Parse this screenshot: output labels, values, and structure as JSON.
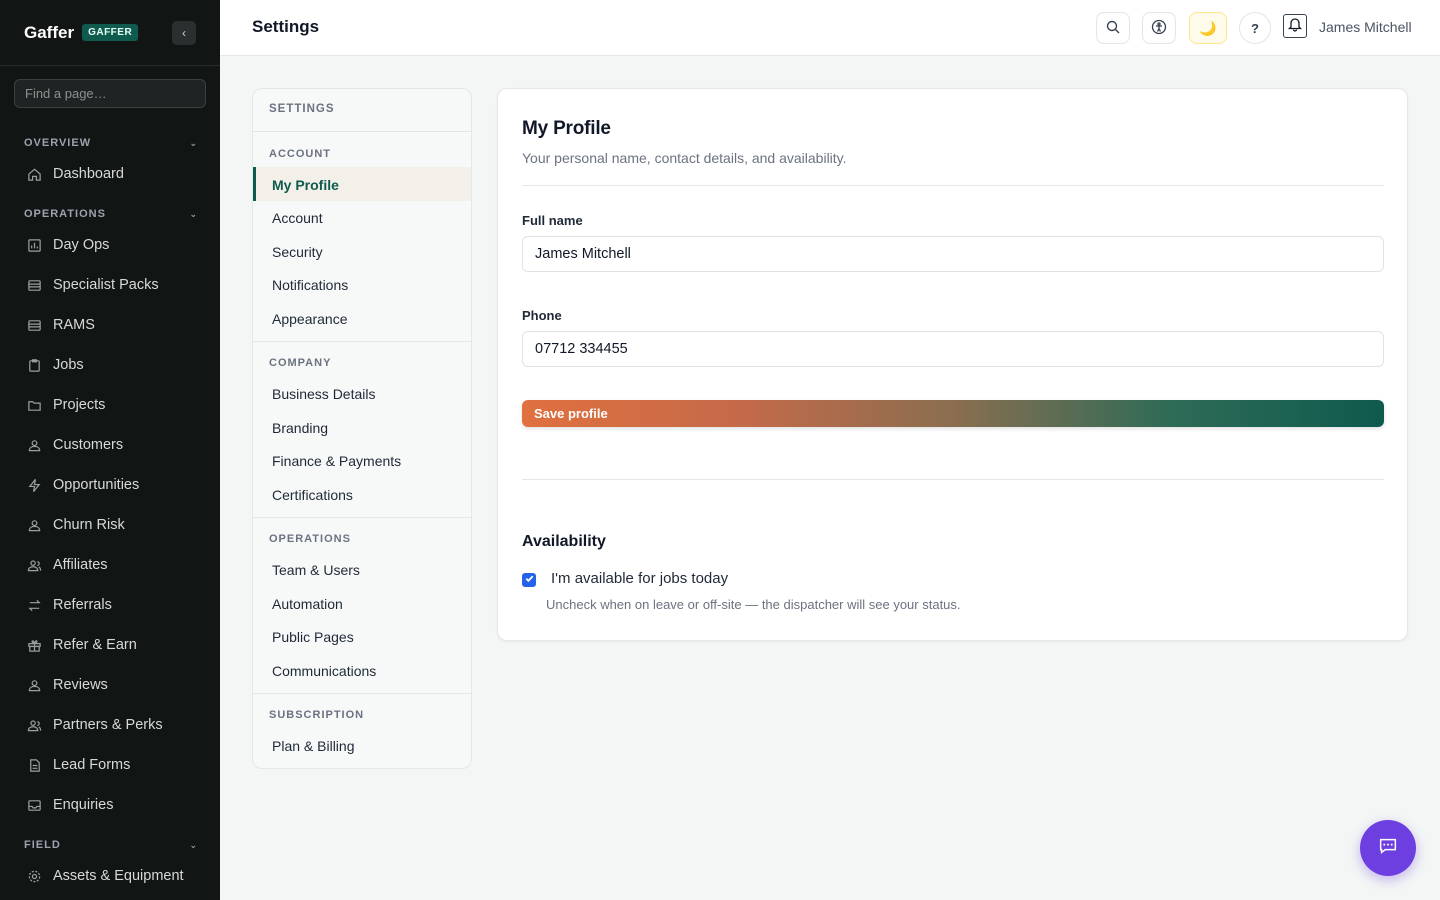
{
  "sidebar": {
    "brand": "Gaffer",
    "badge": "GAFFER",
    "search_placeholder": "Find a page…",
    "sections": [
      {
        "label": "OVERVIEW",
        "items": [
          {
            "label": "Dashboard",
            "icon": "home-icon"
          }
        ]
      },
      {
        "label": "OPERATIONS",
        "items": [
          {
            "label": "Day Ops",
            "icon": "chart-icon"
          },
          {
            "label": "Specialist Packs",
            "icon": "list-icon"
          },
          {
            "label": "RAMS",
            "icon": "list-icon"
          },
          {
            "label": "Jobs",
            "icon": "clipboard-icon"
          },
          {
            "label": "Projects",
            "icon": "folder-icon"
          },
          {
            "label": "Customers",
            "icon": "user-icon"
          },
          {
            "label": "Opportunities",
            "icon": "bolt-icon"
          },
          {
            "label": "Churn Risk",
            "icon": "user-icon"
          },
          {
            "label": "Affiliates",
            "icon": "users-icon"
          },
          {
            "label": "Referrals",
            "icon": "swap-icon"
          },
          {
            "label": "Refer & Earn",
            "icon": "gift-icon"
          },
          {
            "label": "Reviews",
            "icon": "user-icon"
          },
          {
            "label": "Partners & Perks",
            "icon": "users-icon"
          },
          {
            "label": "Lead Forms",
            "icon": "document-icon"
          },
          {
            "label": "Enquiries",
            "icon": "inbox-icon"
          }
        ]
      },
      {
        "label": "FIELD",
        "items": [
          {
            "label": "Assets & Equipment",
            "icon": "gear-icon"
          }
        ]
      }
    ]
  },
  "header": {
    "title": "Settings",
    "user_name": "James Mitchell",
    "help_label": "?",
    "theme_glyph": "🌙"
  },
  "settings_nav": {
    "title": "SETTINGS",
    "groups": [
      {
        "label": "ACCOUNT",
        "items": [
          "My Profile",
          "Account",
          "Security",
          "Notifications",
          "Appearance"
        ]
      },
      {
        "label": "COMPANY",
        "items": [
          "Business Details",
          "Branding",
          "Finance & Payments",
          "Certifications"
        ]
      },
      {
        "label": "OPERATIONS",
        "items": [
          "Team & Users",
          "Automation",
          "Public Pages",
          "Communications"
        ]
      },
      {
        "label": "SUBSCRIPTION",
        "items": [
          "Plan & Billing"
        ]
      }
    ],
    "active": "My Profile"
  },
  "profile": {
    "title": "My Profile",
    "subtitle": "Your personal name, contact details, and availability.",
    "full_name_label": "Full name",
    "full_name_value": "James Mitchell",
    "phone_label": "Phone",
    "phone_value": "07712 334455",
    "save_label": "Save profile",
    "availability_title": "Availability",
    "available_label": "I'm available for jobs today",
    "available_checked": true,
    "available_help": "Uncheck when on leave or off-site — the dispatcher will see your status."
  },
  "colors": {
    "accent": "#0f5b4d",
    "sidebar_bg": "#111615",
    "chat_fab": "#6d3fe0",
    "checkbox": "#2563eb"
  }
}
